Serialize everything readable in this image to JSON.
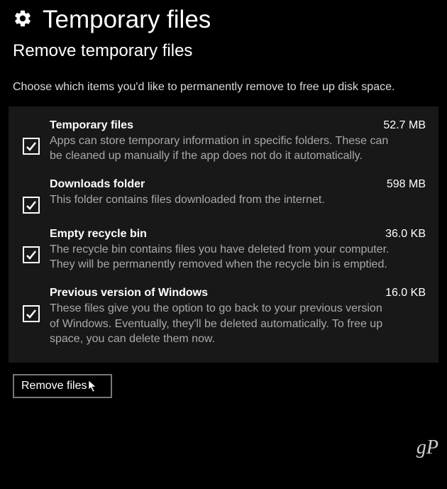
{
  "header": {
    "title": "Temporary files",
    "subtitle": "Remove temporary files",
    "description": "Choose which items you'd like to permanently remove to free up disk space."
  },
  "items": [
    {
      "title": "Temporary files",
      "size": "52.7 MB",
      "description": "Apps can store temporary information in specific folders. These can be cleaned up manually if the app does not do it automatically.",
      "checked": true
    },
    {
      "title": "Downloads folder",
      "size": "598 MB",
      "description": "This folder contains files downloaded from the internet.",
      "checked": true
    },
    {
      "title": "Empty recycle bin",
      "size": "36.0 KB",
      "description": "The recycle bin contains files you have deleted from your computer. They will be permanently removed when the recycle bin is emptied.",
      "checked": true
    },
    {
      "title": "Previous version of Windows",
      "size": "16.0 KB",
      "description": "These files give you the option to go back to your previous version of Windows. Eventually, they'll be deleted automatically. To free up space, you can delete them now.",
      "checked": true
    }
  ],
  "actions": {
    "remove_label": "Remove files"
  },
  "watermark": "gP"
}
